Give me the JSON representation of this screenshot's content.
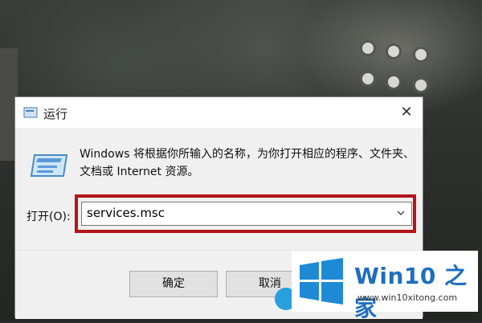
{
  "dialog": {
    "title": "运行",
    "close_glyph": "✕",
    "description": "Windows 将根据你所输入的名称，为你打开相应的程序、文件夹、文档或 Internet 资源。",
    "open_label": "打开(O):",
    "open_value": "services.msc",
    "ok_label": "确定",
    "cancel_label": "取消"
  },
  "watermark": {
    "title": "Win10 之家",
    "url": "www.win10xitong.com"
  },
  "colors": {
    "highlight": "#b3151b",
    "brand_blue": "#1e6fbf"
  }
}
